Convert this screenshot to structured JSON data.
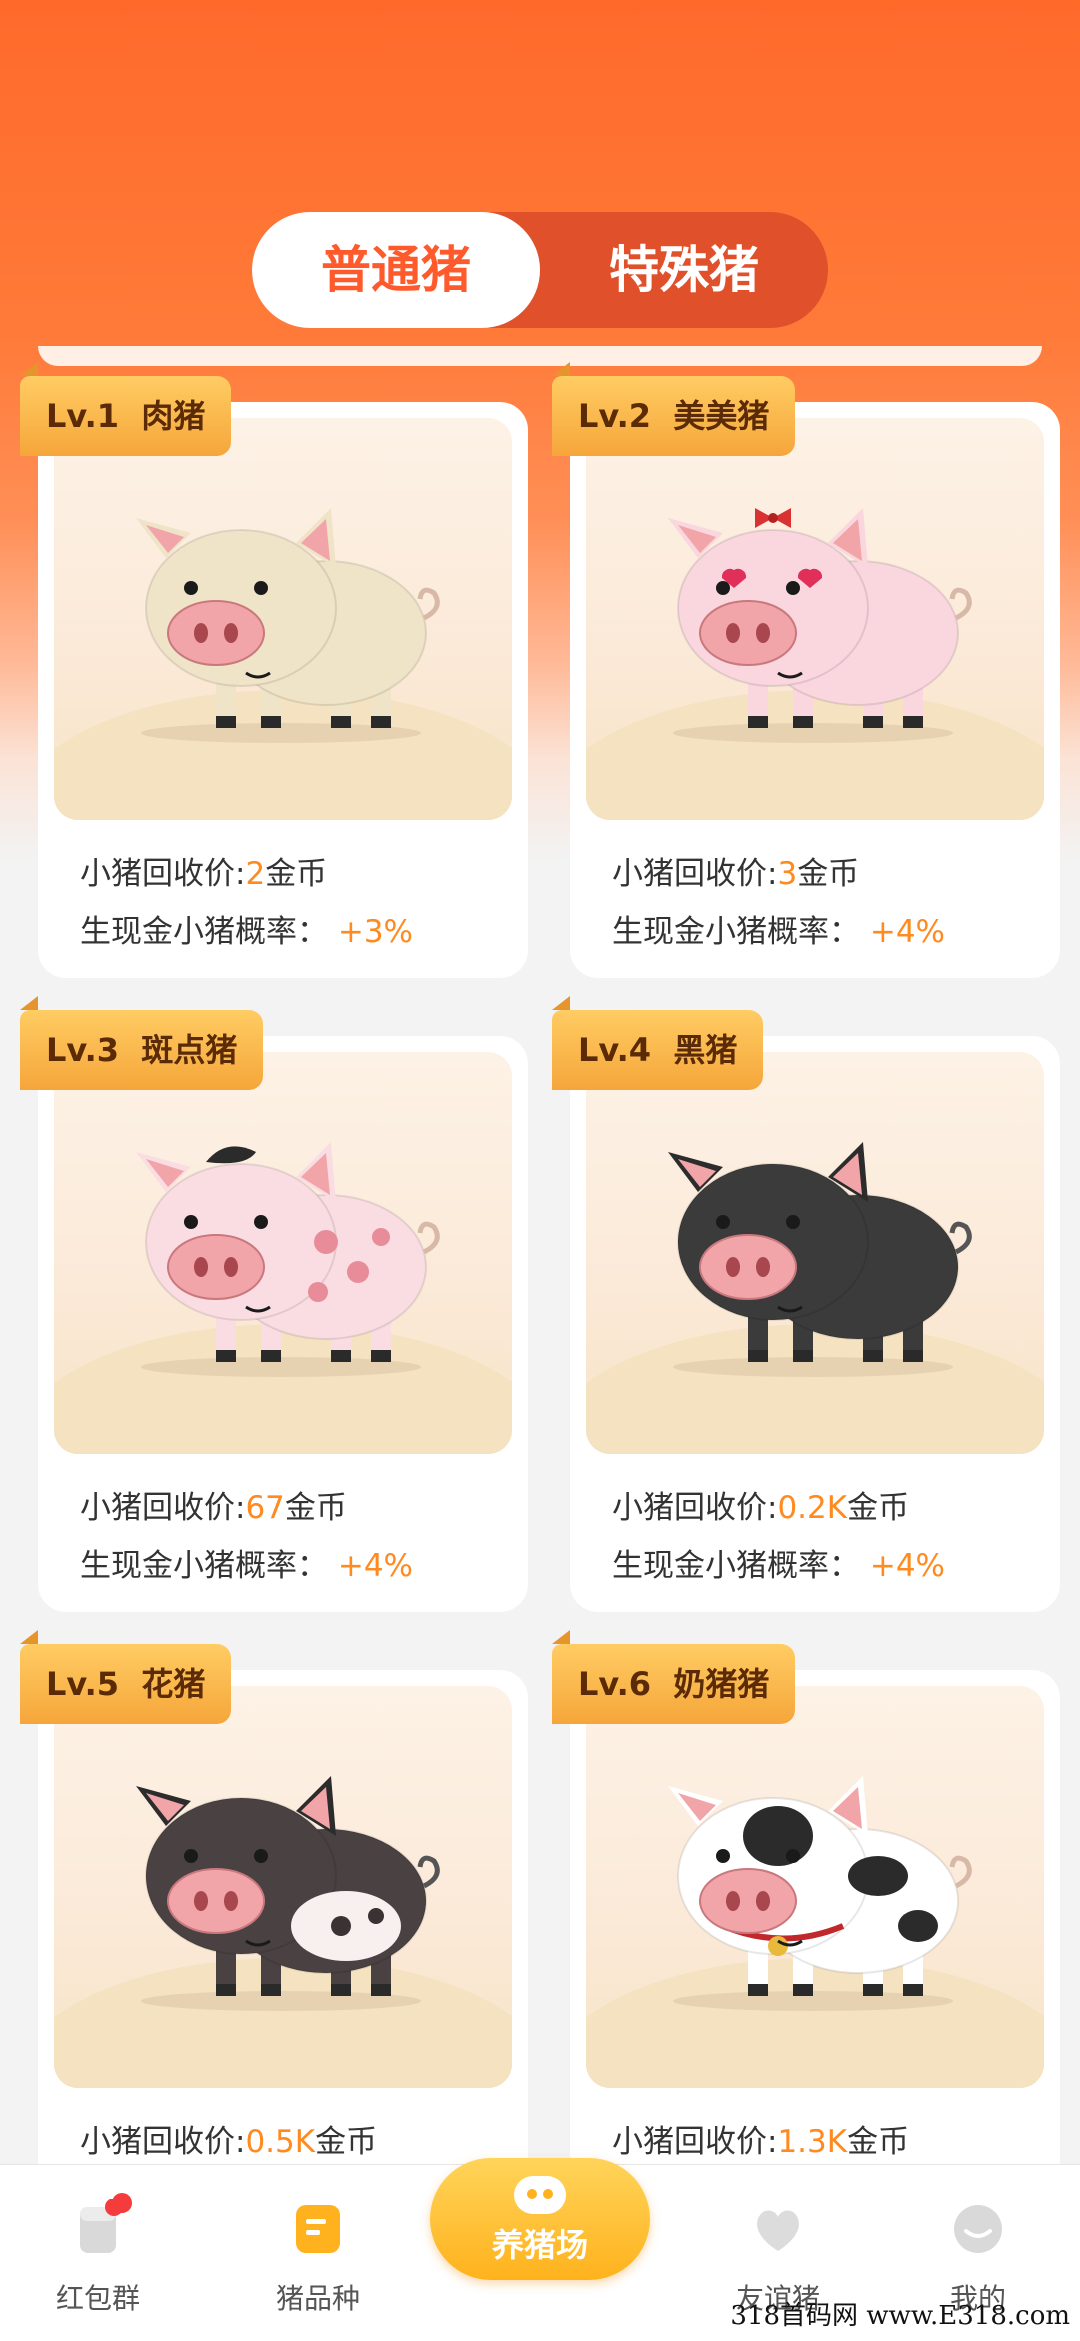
{
  "segment": {
    "tabs": [
      "普通猪",
      "特殊猪"
    ],
    "active": "普通猪"
  },
  "labels": {
    "price_prefix": "小猪回收价:",
    "price_unit": "金币",
    "chance_prefix": "生现金小猪概率："
  },
  "cards": [
    {
      "level": "Lv.1",
      "name": "肉猪",
      "price": "2",
      "chance": "+3%",
      "pig_type": "plain-pig-icon",
      "color": "#efe4c8"
    },
    {
      "level": "Lv.2",
      "name": "美美猪",
      "price": "3",
      "chance": "+4%",
      "pig_type": "pretty-pig-icon",
      "color": "#fad6df"
    },
    {
      "level": "Lv.3",
      "name": "斑点猪",
      "price": "67",
      "chance": "+4%",
      "pig_type": "spotted-pig-icon",
      "color": "#fadde2"
    },
    {
      "level": "Lv.4",
      "name": "黑猪",
      "price": "0.2K",
      "chance": "+4%",
      "pig_type": "black-pig-icon",
      "color": "#3b3b3b"
    },
    {
      "level": "Lv.5",
      "name": "花猪",
      "price": "0.5K",
      "chance": "",
      "pig_type": "patched-pig-icon",
      "color": "#4a4242"
    },
    {
      "level": "Lv.6",
      "name": "奶猪猪",
      "price": "1.3K",
      "chance": "",
      "pig_type": "cow-pig-icon",
      "color": "#ffffff"
    }
  ],
  "tabbar": {
    "items": [
      {
        "label": "红包群",
        "icon": "red-packet-group-icon",
        "badge": true
      },
      {
        "label": "猪品种",
        "icon": "pig-breeds-icon"
      },
      {
        "label": "养猪场",
        "icon": "pig-farm-icon",
        "center": true
      },
      {
        "label": "友谊猪",
        "icon": "friendship-pig-icon"
      },
      {
        "label": "我的",
        "icon": "profile-icon"
      }
    ]
  },
  "watermark": "318首码网 www.E318.com",
  "colors": {
    "accent": "#ff5a2c",
    "value_orange": "#ff8a1f",
    "badge_gold": "#f5a63a"
  }
}
